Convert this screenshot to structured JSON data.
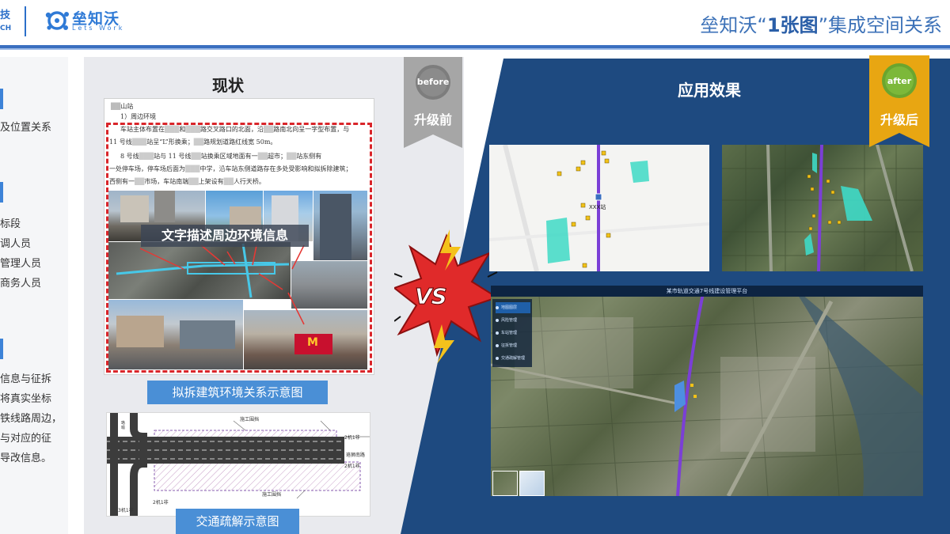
{
  "header": {
    "brand_left_line1": "技",
    "brand_left_line2": "CH",
    "logo_name": "垒知沃",
    "logo_sub": "Lets Work",
    "title_prefix": "垒知沃“",
    "title_strong": "1张图",
    "title_suffix": "”集成空间关系"
  },
  "left_panel": {
    "line1": "及位置关系",
    "line2": "标段",
    "line3": "调人员",
    "line4": "管理人员",
    "line5": "商务人员",
    "line6": "信息与征拆",
    "line7": "将真实坐标",
    "line8": "铁线路周边，",
    "line9": "与对应的征",
    "line10": "导改信息。"
  },
  "before": {
    "title": "现状",
    "badge_en": "before",
    "badge_cn": "升级前",
    "doc_heading": "山站",
    "doc_subheading": "1）周边环境",
    "doc_p1a": "车站主体布置在",
    "doc_p1b": "和",
    "doc_p1c": "路交叉路口的北面，沿",
    "doc_p1d": "路南北向呈一字型布置，与",
    "doc_p2a": "11 号线",
    "doc_p2b": "站呈“L”形换乘；",
    "doc_p2c": "路规划道路红线宽 50m。",
    "doc_p3a": "8 号线",
    "doc_p3b": "站与 11 号线",
    "doc_p3c": "站换乘区域地面有一",
    "doc_p3d": "超市；",
    "doc_p3e": "站东侧有",
    "doc_p4a": "一处停车场，停车场后面为",
    "doc_p4b": "中学，沿车站东侧道路存在多处受影响和拟拆除建筑；",
    "doc_p5a": "西侧有一",
    "doc_p5b": "市场，车站南端",
    "doc_p5c": "上架设有",
    "doc_p5d": "人行天桥。",
    "photo_label": "文字描述周边环境信息",
    "caption1": "拟拆建筑环境关系示意图",
    "caption2": "交通疏解示意图",
    "traffic_label1": "施工围挡",
    "traffic_label2": "施工围挡",
    "traffic_label3": "2机1非",
    "traffic_label4": "2机1非",
    "traffic_label5": "2机1非",
    "traffic_label6": "3机1非",
    "traffic_label7": "珞狮南路",
    "traffic_label8": "珞喻"
  },
  "vs_text": "VS",
  "after": {
    "title": "应用效果",
    "badge_en": "after",
    "badge_cn": "升级后",
    "map_station_label": "XXX站",
    "platform_title": "某市轨道交通7号线建设管理平台",
    "menu": [
      "地图图层",
      "风险管理",
      "车站管理",
      "征拆管理",
      "交通疏解管理"
    ]
  },
  "colors": {
    "accent_blue": "#3a6fc0",
    "after_panel_bg": "#1e4a80",
    "badge_gray": "#a6a6a6",
    "badge_gold": "#e8a612",
    "dash_red": "#d9252a",
    "caption_blue": "#4a8fd6",
    "rail_purple": "#7b3fd6",
    "land_cyan": "#3ed9c6"
  }
}
